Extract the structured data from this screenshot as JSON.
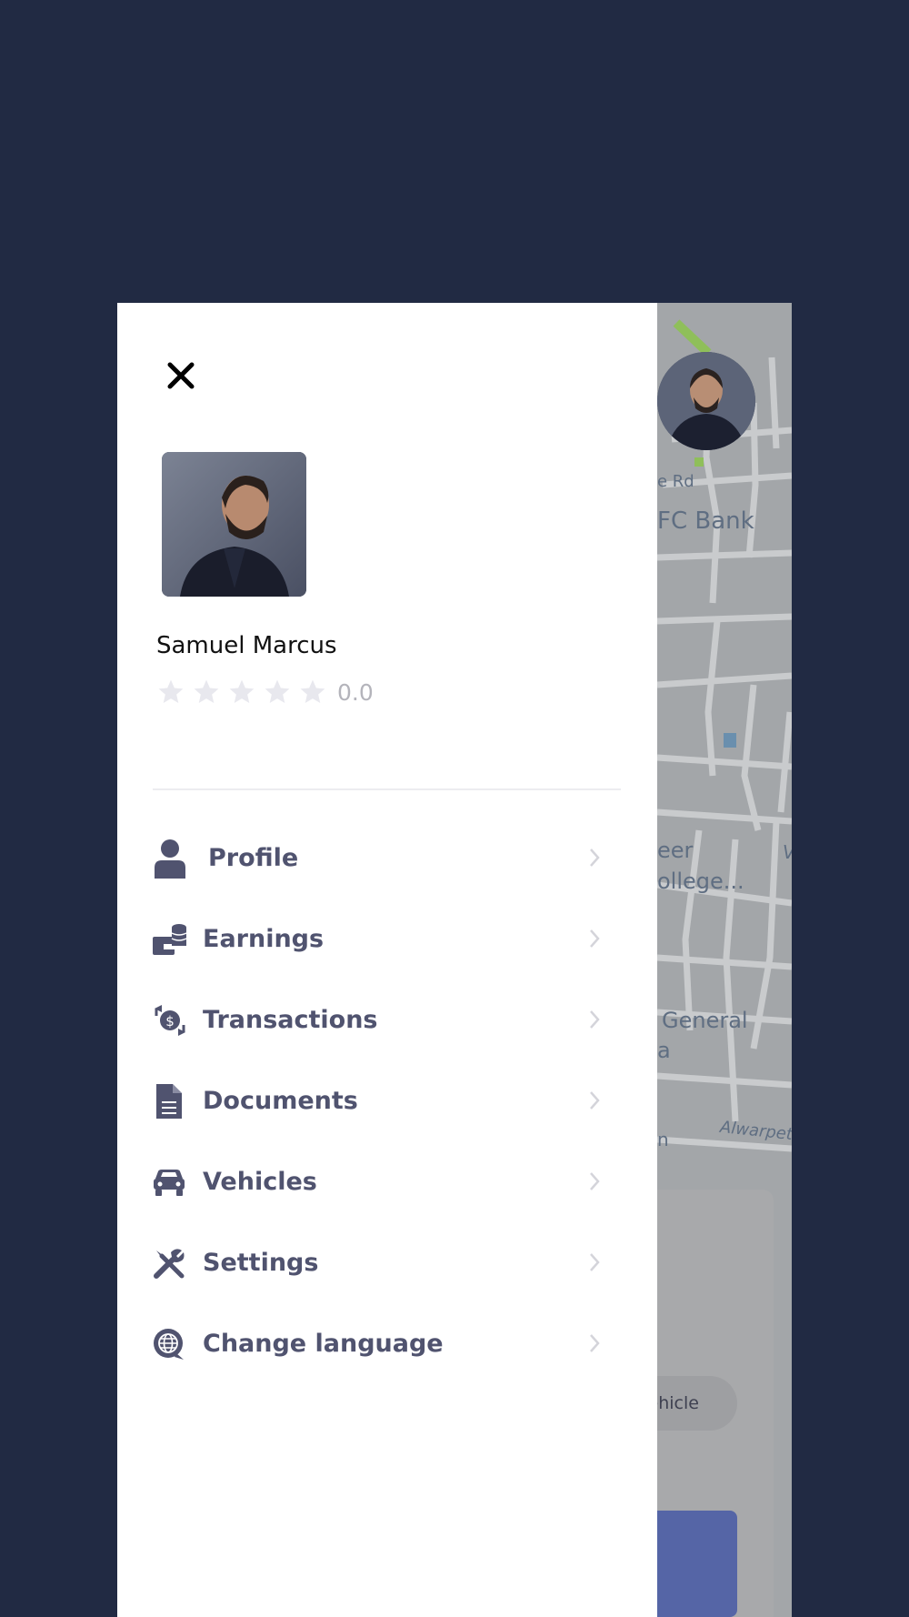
{
  "map": {
    "labels": [
      "e Rd",
      "FC Bank",
      "eer",
      "ollege...",
      "General",
      "a",
      "Alwarpet",
      "V",
      "n"
    ],
    "vehicle_button": "Vehicle"
  },
  "drawer": {
    "close_icon": "close-icon",
    "user": {
      "name": "Samuel Marcus",
      "rating": "0.0",
      "stars_filled": 0,
      "stars_total": 5
    },
    "menu": [
      {
        "label": "Profile",
        "icon": "person-icon"
      },
      {
        "label": "Earnings",
        "icon": "wallet-coins-icon"
      },
      {
        "label": "Transactions",
        "icon": "exchange-icon"
      },
      {
        "label": "Documents",
        "icon": "document-icon"
      },
      {
        "label": "Vehicles",
        "icon": "car-icon"
      },
      {
        "label": "Settings",
        "icon": "tools-icon"
      },
      {
        "label": "Change language",
        "icon": "globe-chat-icon"
      }
    ]
  },
  "colors": {
    "page_background": "#212a43",
    "menu_text": "#50536f",
    "accent_blue": "#5565a6"
  }
}
